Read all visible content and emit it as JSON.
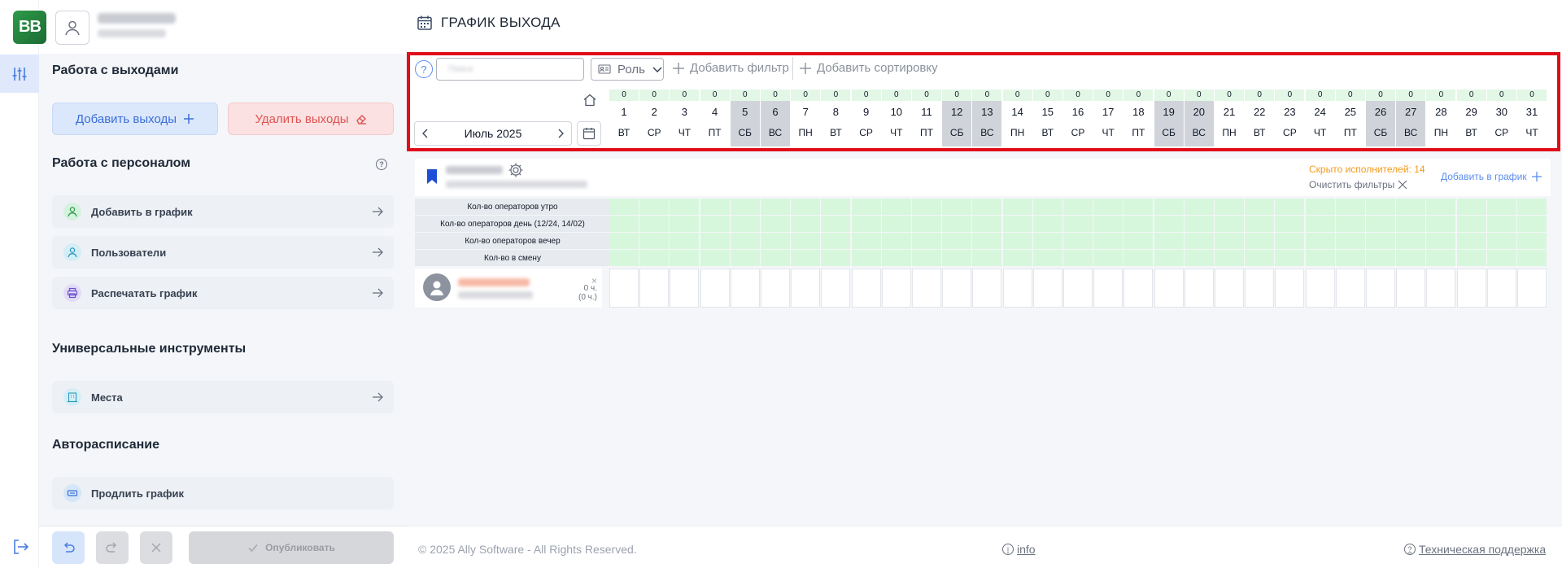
{
  "app": {
    "logo": "BB",
    "page_title": "ГРАФИК ВЫХОДА"
  },
  "sidebar": {
    "sections": {
      "outs": "Работа с выходами",
      "staff": "Работа с персоналом",
      "tools": "Универсальные инструменты",
      "auto": "Авторасписание"
    },
    "buttons": {
      "add_outs": "Добавить выходы",
      "delete_outs": "Удалить выходы"
    },
    "items": {
      "add_to_schedule": "Добавить в график",
      "users": "Пользователи",
      "print_schedule": "Распечатать график",
      "places": "Места",
      "extend_schedule": "Продлить график"
    },
    "publish": "Опубликовать"
  },
  "toolbar": {
    "help": "?",
    "search_placeholder": "Поиск",
    "role": "Роль",
    "add_filter": "Добавить фильтр",
    "add_sort": "Добавить сортировку"
  },
  "calendar": {
    "month": "Июль 2025",
    "days": [
      {
        "n": "1",
        "wd": "ВТ",
        "c": "0",
        "we": false
      },
      {
        "n": "2",
        "wd": "СР",
        "c": "0",
        "we": false
      },
      {
        "n": "3",
        "wd": "ЧТ",
        "c": "0",
        "we": false
      },
      {
        "n": "4",
        "wd": "ПТ",
        "c": "0",
        "we": false
      },
      {
        "n": "5",
        "wd": "СБ",
        "c": "0",
        "we": true
      },
      {
        "n": "6",
        "wd": "ВС",
        "c": "0",
        "we": true
      },
      {
        "n": "7",
        "wd": "ПН",
        "c": "0",
        "we": false
      },
      {
        "n": "8",
        "wd": "ВТ",
        "c": "0",
        "we": false
      },
      {
        "n": "9",
        "wd": "СР",
        "c": "0",
        "we": false
      },
      {
        "n": "10",
        "wd": "ЧТ",
        "c": "0",
        "we": false
      },
      {
        "n": "11",
        "wd": "ПТ",
        "c": "0",
        "we": false
      },
      {
        "n": "12",
        "wd": "СБ",
        "c": "0",
        "we": true
      },
      {
        "n": "13",
        "wd": "ВС",
        "c": "0",
        "we": true
      },
      {
        "n": "14",
        "wd": "ПН",
        "c": "0",
        "we": false
      },
      {
        "n": "15",
        "wd": "ВТ",
        "c": "0",
        "we": false
      },
      {
        "n": "16",
        "wd": "СР",
        "c": "0",
        "we": false
      },
      {
        "n": "17",
        "wd": "ЧТ",
        "c": "0",
        "we": false
      },
      {
        "n": "18",
        "wd": "ПТ",
        "c": "0",
        "we": false
      },
      {
        "n": "19",
        "wd": "СБ",
        "c": "0",
        "we": true
      },
      {
        "n": "20",
        "wd": "ВС",
        "c": "0",
        "we": true
      },
      {
        "n": "21",
        "wd": "ПН",
        "c": "0",
        "we": false
      },
      {
        "n": "22",
        "wd": "ВТ",
        "c": "0",
        "we": false
      },
      {
        "n": "23",
        "wd": "СР",
        "c": "0",
        "we": false
      },
      {
        "n": "24",
        "wd": "ЧТ",
        "c": "0",
        "we": false
      },
      {
        "n": "25",
        "wd": "ПТ",
        "c": "0",
        "we": false
      },
      {
        "n": "26",
        "wd": "СБ",
        "c": "0",
        "we": true
      },
      {
        "n": "27",
        "wd": "ВС",
        "c": "0",
        "we": true
      },
      {
        "n": "28",
        "wd": "ПН",
        "c": "0",
        "we": false
      },
      {
        "n": "29",
        "wd": "ВТ",
        "c": "0",
        "we": false
      },
      {
        "n": "30",
        "wd": "СР",
        "c": "0",
        "we": false
      },
      {
        "n": "31",
        "wd": "ЧТ",
        "c": "0",
        "we": false
      }
    ]
  },
  "group": {
    "hidden_executors": "Скрыто исполнителей: 14",
    "clear_filters": "Очистить фильтры",
    "add_to_schedule": "Добавить в график"
  },
  "stats": [
    "Кол-во операторов утро",
    "Кол-во операторов день (12/24, 14/02)",
    "Кол-во операторов вечер",
    "Кол-во в смену"
  ],
  "person": {
    "hours": "0 ч.",
    "hours_paren": "(0 ч.)",
    "close": "×"
  },
  "footer": {
    "copyright": "© 2025 Ally Software - All Rights Reserved.",
    "info": "info",
    "support": "Техническая поддержка"
  },
  "colors": {
    "brand": "#2e9b49",
    "accent": "#5b8ef0",
    "highlight": "#e00d1a",
    "warning": "#f39a1c"
  }
}
